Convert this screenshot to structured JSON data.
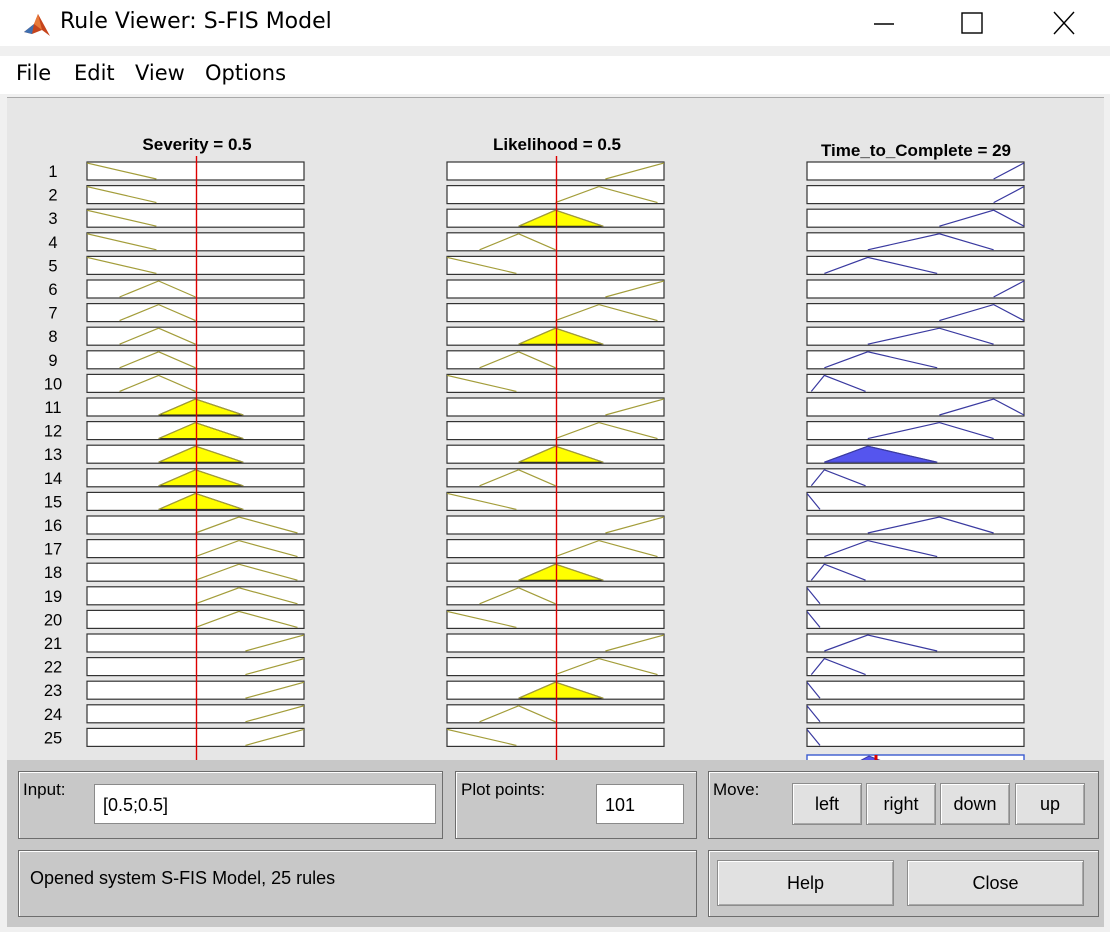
{
  "window": {
    "title": "Rule Viewer: S-FIS Model",
    "controls": [
      "minimize-icon",
      "maximize-icon",
      "close-icon"
    ]
  },
  "menu": [
    "File",
    "Edit",
    "View",
    "Options"
  ],
  "columns": [
    {
      "label": "Severity = 0.5",
      "input_value": 0.5
    },
    {
      "label": "Likelihood = 0.5",
      "input_value": 0.5
    },
    {
      "label": "Time_to_Complete = 29"
    }
  ],
  "rules": [
    {
      "n": "1",
      "in1": "low",
      "in2": "high",
      "out": "vhigh"
    },
    {
      "n": "2",
      "in1": "low",
      "in2": "mhigh",
      "out": "vhigh"
    },
    {
      "n": "3",
      "in1": "low",
      "in2": "medium",
      "out": "high"
    },
    {
      "n": "4",
      "in1": "low",
      "in2": "mlow",
      "out": "mhigh"
    },
    {
      "n": "5",
      "in1": "low",
      "in2": "low",
      "out": "medium"
    },
    {
      "n": "6",
      "in1": "mlow",
      "in2": "high",
      "out": "vhigh"
    },
    {
      "n": "7",
      "in1": "mlow",
      "in2": "mhigh",
      "out": "high"
    },
    {
      "n": "8",
      "in1": "mlow",
      "in2": "medium",
      "out": "mhigh"
    },
    {
      "n": "9",
      "in1": "mlow",
      "in2": "mlow",
      "out": "medium"
    },
    {
      "n": "10",
      "in1": "mlow",
      "in2": "low",
      "out": "mlow"
    },
    {
      "n": "11",
      "in1": "medium",
      "in2": "high",
      "out": "high"
    },
    {
      "n": "12",
      "in1": "medium",
      "in2": "mhigh",
      "out": "mhigh"
    },
    {
      "n": "13",
      "in1": "medium",
      "in2": "medium",
      "out": "medium"
    },
    {
      "n": "14",
      "in1": "medium",
      "in2": "mlow",
      "out": "mlow"
    },
    {
      "n": "15",
      "in1": "medium",
      "in2": "low",
      "out": "vlow"
    },
    {
      "n": "16",
      "in1": "mhigh",
      "in2": "high",
      "out": "mhigh"
    },
    {
      "n": "17",
      "in1": "mhigh",
      "in2": "mhigh",
      "out": "medium"
    },
    {
      "n": "18",
      "in1": "mhigh",
      "in2": "medium",
      "out": "mlow"
    },
    {
      "n": "19",
      "in1": "mhigh",
      "in2": "mlow",
      "out": "vlow"
    },
    {
      "n": "20",
      "in1": "mhigh",
      "in2": "low",
      "out": "vlow"
    },
    {
      "n": "21",
      "in1": "high",
      "in2": "high",
      "out": "medium"
    },
    {
      "n": "22",
      "in1": "high",
      "in2": "mhigh",
      "out": "mlow"
    },
    {
      "n": "23",
      "in1": "high",
      "in2": "medium",
      "out": "vlow"
    },
    {
      "n": "24",
      "in1": "high",
      "in2": "mlow",
      "out": "vlow"
    },
    {
      "n": "25",
      "in1": "high",
      "in2": "low",
      "out": "vlow"
    }
  ],
  "controls": {
    "input_label": "Input:",
    "input_value": "[0.5;0.5]",
    "plot_points_label": "Plot points:",
    "plot_points_value": "101",
    "move_label": "Move:",
    "move_buttons": [
      "left",
      "right",
      "down",
      "up"
    ],
    "status": "Opened system S-FIS Model, 25 rules",
    "help_label": "Help",
    "close_label": "Close"
  },
  "colors": {
    "input_mf_line": "#a39d3a",
    "input_fill": "#ffff00",
    "output_mf_line": "#3a3aa0",
    "output_fill": "#5555ee",
    "index_line": "#dd0000",
    "plot_bg": "#ffffff",
    "panel_bg": "#e6e6e6"
  }
}
